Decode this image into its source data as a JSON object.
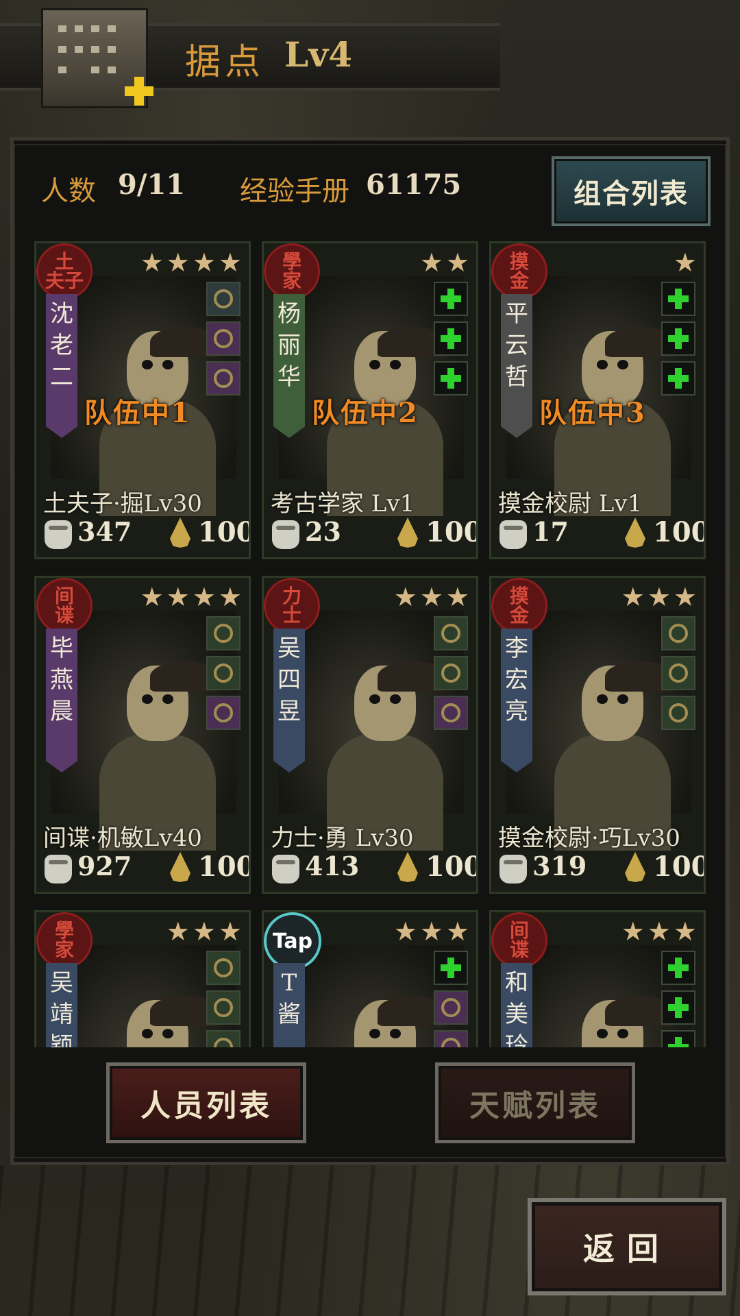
{
  "header": {
    "title": "据点",
    "level": "Lv4"
  },
  "stats": {
    "count_label": "人数",
    "count_value": "9/11",
    "exp_label": "经验手册",
    "exp_value": "61175"
  },
  "combo_button": "组合列表",
  "characters": [
    {
      "stamp": [
        "土",
        "夫子"
      ],
      "stars": 4,
      "name_chars": [
        "沈",
        "老",
        "二"
      ],
      "ribbon_color": "#5a3a6a",
      "equip": [
        "item",
        "item purple",
        "item purple"
      ],
      "team": "队伍中1",
      "title": "土夫子·掘Lv30",
      "power": "347",
      "energy": "100"
    },
    {
      "stamp": [
        "學",
        "家"
      ],
      "stars": 2,
      "name_chars": [
        "杨",
        "丽",
        "华"
      ],
      "ribbon_color": "#3f5e3a",
      "equip": [
        "empty",
        "empty",
        "empty"
      ],
      "team": "队伍中2",
      "title": "考古学家 Lv1",
      "power": "23",
      "energy": "100"
    },
    {
      "stamp": [
        "摸",
        "金"
      ],
      "stars": 1,
      "name_chars": [
        "平",
        "云",
        "哲"
      ],
      "ribbon_color": "#4e4e4e",
      "equip": [
        "empty",
        "empty",
        "empty"
      ],
      "team": "队伍中3",
      "title": "摸金校尉 Lv1",
      "power": "17",
      "energy": "100"
    },
    {
      "stamp": [
        "间",
        "谍"
      ],
      "stars": 4,
      "name_chars": [
        "毕",
        "燕",
        "晨"
      ],
      "ribbon_color": "#5a3a6a",
      "equip": [
        "item green",
        "item green",
        "item purple"
      ],
      "team": "",
      "title": "间谍·机敏Lv40",
      "power": "927",
      "energy": "100"
    },
    {
      "stamp": [
        "力",
        "士"
      ],
      "stars": 3,
      "name_chars": [
        "吴",
        "四",
        "昱"
      ],
      "ribbon_color": "#3a4a63",
      "equip": [
        "item green",
        "item green",
        "item purple"
      ],
      "team": "",
      "title": "力士·勇 Lv30",
      "power": "413",
      "energy": "100"
    },
    {
      "stamp": [
        "摸",
        "金"
      ],
      "stars": 3,
      "name_chars": [
        "李",
        "宏",
        "亮"
      ],
      "ribbon_color": "#3a4a63",
      "equip": [
        "item green",
        "item green",
        "item green"
      ],
      "team": "",
      "title": "摸金校尉·巧Lv30",
      "power": "319",
      "energy": "100"
    },
    {
      "stamp": [
        "學",
        "家"
      ],
      "stars": 3,
      "name_chars": [
        "吴",
        "靖",
        "颖"
      ],
      "ribbon_color": "#3a4a63",
      "equip": [
        "item green",
        "item green",
        "item green"
      ],
      "team": "",
      "title": "",
      "power": "",
      "energy": ""
    },
    {
      "stamp": [
        "Tap"
      ],
      "stars": 3,
      "name_chars": [
        "T",
        "酱"
      ],
      "ribbon_color": "#3a4a63",
      "is_tap": true,
      "equip": [
        "empty",
        "item purple",
        "item purple"
      ],
      "team": "",
      "title": "",
      "power": "",
      "energy": ""
    },
    {
      "stamp": [
        "间",
        "谍"
      ],
      "stars": 3,
      "name_chars": [
        "和",
        "美",
        "玲"
      ],
      "ribbon_color": "#3a4a63",
      "equip": [
        "empty",
        "empty",
        "empty"
      ],
      "team": "",
      "title": "",
      "power": "",
      "energy": ""
    }
  ],
  "bottom_buttons": {
    "staff": "人员列表",
    "talent": "天赋列表"
  },
  "back_button": "返回",
  "colors": {
    "accent": "#d89a3a",
    "stamp_red": "#8f1c1c",
    "plus_green": "#2ed12e",
    "star": "#d6b887"
  }
}
